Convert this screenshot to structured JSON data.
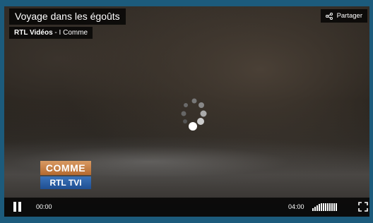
{
  "video": {
    "title": "Voyage dans les égoûts",
    "source": "RTL Vidéos",
    "source_sep": " - ",
    "program": "I Comme",
    "share_label": "Partager",
    "logo_top": "COMME",
    "logo_bottom": "RTL TVI"
  },
  "controls": {
    "current_time": "00:00",
    "duration": "04:00",
    "volume_level": 1.0
  },
  "icons": {
    "share": "share-icon",
    "spinner": "loading-spinner-icon",
    "pause": "pause-icon",
    "volume": "volume-icon",
    "fullscreen": "fullscreen-icon"
  },
  "colors": {
    "frame": "#1c5b7c",
    "overlay": "#000000",
    "text": "#ffffff"
  }
}
